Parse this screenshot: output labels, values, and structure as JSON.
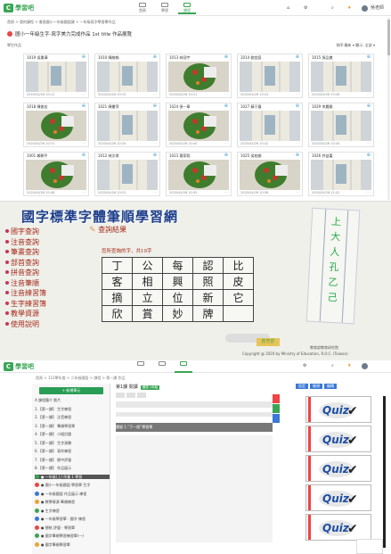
{
  "panel1": {
    "logo_mark": "C",
    "logo_text": "學習吧",
    "nav": [
      "首頁",
      "學習",
      "課程"
    ],
    "active_nav": 2,
    "user": "吳老師",
    "breadcrumb": "首頁 > 我的課程 > 會昌國小一年級國語課 > 一年級寫字學習單作品",
    "title": "國小一年級生字-寫字美力完成作品 1st title 作品展覽",
    "subtitle": "學生作品",
    "filters": "排序:最新 ▾    顯示: 全部 ▾",
    "cards": [
      {
        "name": "1019 吳秉澤",
        "date": "2020/04/26 10:12"
      },
      {
        "name": "1010 陳維翰",
        "date": "2020/04/26 10:15"
      },
      {
        "name": "1013 林冠宇",
        "date": "2020/04/26 10:21"
      },
      {
        "name": "1014 劉宜庭",
        "date": "2020/04/26 10:24"
      },
      {
        "name": "1015 張品崴",
        "date": "2020/04/26 10:26"
      },
      {
        "name": "1018 陳俊宏",
        "date": "2020/04/26 10:31"
      },
      {
        "name": "1021 陳書萍",
        "date": "2020/04/26 10:34"
      },
      {
        "name": "1024 張一寧",
        "date": "2020/04/26 10:40"
      },
      {
        "name": "1027 蘇于寬",
        "date": "2020/04/26 10:42"
      },
      {
        "name": "1029 李晨雅",
        "date": "2020/04/26 10:45"
      },
      {
        "name": "1001 賴朝平",
        "date": "2020/04/26 10:48"
      },
      {
        "name": "1012 林文琪",
        "date": "2020/04/26 10:51"
      },
      {
        "name": "1023 葉家銘",
        "date": "2020/04/26 10:55"
      },
      {
        "name": "1025 吳柏諭",
        "date": "2020/04/26 10:58"
      },
      {
        "name": "1026 許益嘉",
        "date": "2020/04/26 11:02"
      }
    ]
  },
  "panel2": {
    "title": "國字標準字體筆順學習網",
    "menu": [
      "國字查詢",
      "注音查詢",
      "筆畫查詢",
      "部首查詢",
      "拼音查詢",
      "注音筆順",
      "注音練習簿",
      "生字練習簿",
      "教學資源",
      "使用說明"
    ],
    "query_result": "查詢結果",
    "caption": "您所查詢的字，共19字",
    "table": [
      [
        "丁",
        "公",
        "每",
        "認",
        "比"
      ],
      [
        "客",
        "相",
        "興",
        "照",
        "皮"
      ],
      [
        "摘",
        "立",
        "位",
        "新",
        "它"
      ],
      [
        "欣",
        "賞",
        "妙",
        "牌",
        ""
      ]
    ],
    "paper_chars": [
      "上",
      "大",
      "人",
      "孔",
      "乙",
      "己"
    ],
    "stamp": "教育部",
    "footer_a": "教育部教育研究院",
    "footer_b": "Copyright @ 2020 by Ministry of Education, R.O.C. (Taiwan)"
  },
  "panel3": {
    "logo_mark": "C",
    "logo_text": "學習吧",
    "breadcrumb": "首頁 > 112學年度 > 二年級國語 > 課程 > 第一課 作品",
    "add_button": "+ 新增單元",
    "side_items": [
      "A 課程簡介 影片",
      "1.【第一課】 生字練習",
      "2.【第一課】 注音練習",
      "3.【第一課】 筆順學習單",
      "4.【第一課】 小組討論",
      "5.【第一課】 生字測驗",
      "6.【第一課】 寫作練習",
      "7.【第一課】 期中評量",
      "8.【第一課】 作品展示",
      "● 一年級(上) 作業 1 學習",
      "● 國小一年級國語 學習單 生字",
      "● 一年級國語 作品展示 練習",
      "● 教學資源 筆順練習",
      "● 生字練習",
      "● 一年級學習單 - 國字 練習",
      "● 總結 評量 - 學習單",
      "● 國字筆順學習練習單(一)",
      "● 國字筆順學習單"
    ],
    "selected_index": 9,
    "main_title": "第1課 閱讀",
    "main_tag": "國語 1年級",
    "dark_row": "題號                          1.“下一個”學習單",
    "toolbar": [
      "設定",
      "檢視",
      "編輯"
    ],
    "quiz_label": "Quiz",
    "quiz_tick": "✔",
    "quiz_count": 5
  }
}
